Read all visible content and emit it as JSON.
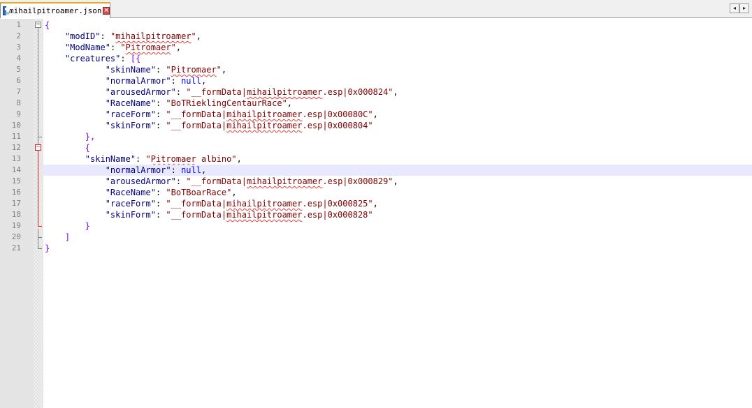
{
  "tab": {
    "filename": "mihailpitroamer.json",
    "icon": "save-disk-icon",
    "close_icon": "close-icon"
  },
  "nav": {
    "left": "◂",
    "right": "▸"
  },
  "colors": {
    "punct": "#8000ff",
    "key": "#000080",
    "string": "#800000",
    "null": "#0000ff",
    "current_line": "#e8e8ff",
    "fold_active": "#cc2222"
  },
  "editor": {
    "current_line": 14,
    "lines": [
      {
        "n": "1"
      },
      {
        "n": "2"
      },
      {
        "n": "3"
      },
      {
        "n": "4"
      },
      {
        "n": "5"
      },
      {
        "n": "6"
      },
      {
        "n": "7"
      },
      {
        "n": "8"
      },
      {
        "n": "9"
      },
      {
        "n": "10"
      },
      {
        "n": "11"
      },
      {
        "n": "12"
      },
      {
        "n": "13"
      },
      {
        "n": "14"
      },
      {
        "n": "15"
      },
      {
        "n": "16"
      },
      {
        "n": "17"
      },
      {
        "n": "18"
      },
      {
        "n": "19"
      },
      {
        "n": "20"
      },
      {
        "n": "21"
      }
    ],
    "text": {
      "l1_brace": "{",
      "l2_key": "\"modID\"",
      "l2_colon": ": ",
      "l2_q1": "\"",
      "l2_val": "mihailpitroamer",
      "l2_q2": "\"",
      "l2_comma": ",",
      "l3_key": "\"ModName\"",
      "l3_colon": ": ",
      "l3_q1": "\"",
      "l3_val": "Pitromaer",
      "l3_q2": "\"",
      "l3_comma": ",",
      "l4_key": "\"creatures\"",
      "l4_colon": ": ",
      "l4_open": "[{",
      "l5_key": "\"skinName\"",
      "l5_colon": ": ",
      "l5_q1": "\"",
      "l5_val": "Pitromaer",
      "l5_q2": "\"",
      "l5_comma": ",",
      "l6_key": "\"normalArmor\"",
      "l6_colon": ": ",
      "l6_val": "null",
      "l6_comma": ",",
      "l7_key": "\"arousedArmor\"",
      "l7_colon": ": ",
      "l7_pre": "\"__formData|",
      "l7_sq": "mihailpitroamer",
      "l7_post": ".esp|0x000824\"",
      "l7_comma": ",",
      "l8_key": "\"RaceName\"",
      "l8_colon": ": ",
      "l8_val": "\"BoTRieklingCentaurRace\"",
      "l8_comma": ",",
      "l9_key": "\"raceForm\"",
      "l9_colon": ": ",
      "l9_pre": "\"__formData|",
      "l9_sq": "mihailpitroamer",
      "l9_post": ".esp|0x00080C\"",
      "l9_comma": ",",
      "l10_key": "\"skinForm\"",
      "l10_colon": ": ",
      "l10_pre": "\"__formData|",
      "l10_sq": "mihailpitroamer",
      "l10_post": ".esp|0x000804\"",
      "l11_close": "},",
      "l12_open": "{",
      "l13_key": "\"skinName\"",
      "l13_colon": ": ",
      "l13_q1": "\"",
      "l13_sq": "Pitromaer",
      "l13_post": " albino\"",
      "l13_comma": ",",
      "l14_key": "\"normalArmor\"",
      "l14_colon": ": ",
      "l14_val": "null",
      "l14_comma": ",",
      "l15_key": "\"arousedArmor\"",
      "l15_colon": ": ",
      "l15_pre": "\"__formData|",
      "l15_sq": "mihailpitroamer",
      "l15_post": ".esp|0x000829\"",
      "l15_comma": ",",
      "l16_key": "\"RaceName\"",
      "l16_colon": ": ",
      "l16_val": "\"BoTBoarRace\"",
      "l16_comma": ",",
      "l17_key": "\"raceForm\"",
      "l17_colon": ": ",
      "l17_pre": "\"__formData|",
      "l17_sq": "mihailpitroamer",
      "l17_post": ".esp|0x000825\"",
      "l17_comma": ",",
      "l18_key": "\"skinForm\"",
      "l18_colon": ": ",
      "l18_pre": "\"__formData|",
      "l18_sq": "mihailpitroamer",
      "l18_post": ".esp|0x000828\"",
      "l19_close": "}",
      "l20_close": "]",
      "l21_close": "}"
    }
  }
}
